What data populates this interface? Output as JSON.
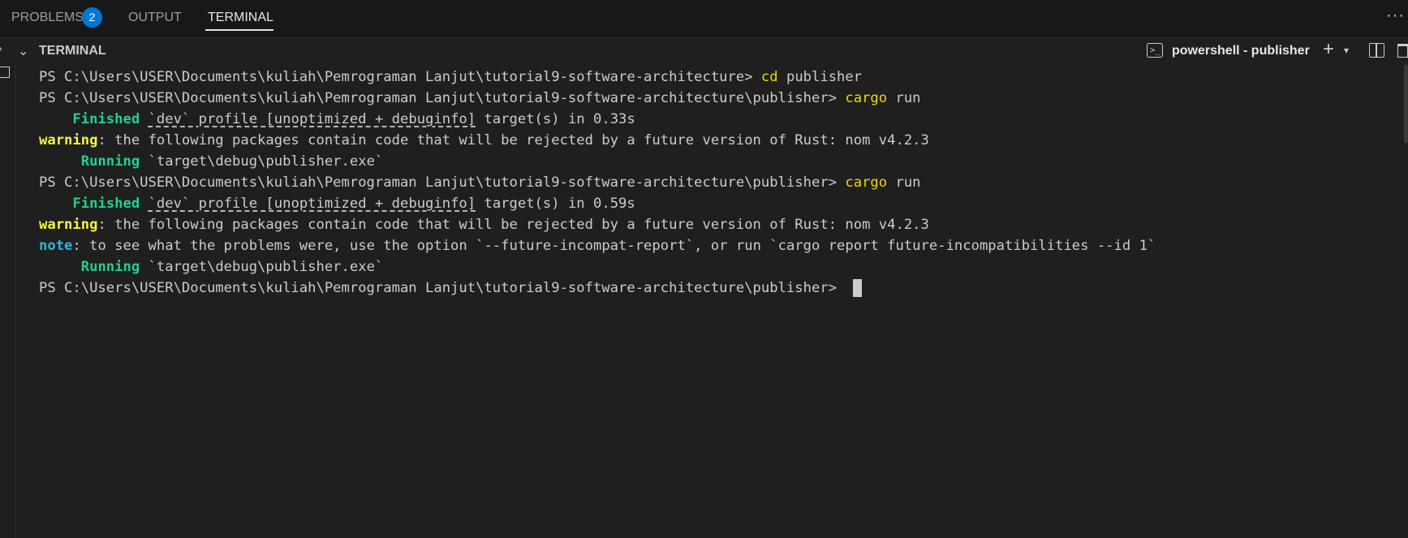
{
  "tabs": {
    "problems": {
      "label": "PROBLEMS",
      "badge": "2"
    },
    "output": {
      "label": "OUTPUT"
    },
    "terminal": {
      "label": "TERMINAL"
    },
    "more_icon": "ellipsis-icon"
  },
  "panel": {
    "section_title": "TERMINAL",
    "shell_name": "powershell - publisher",
    "shell_icon_glyph": ">_",
    "actions": {
      "new_terminal": "+",
      "new_terminal_dropdown": "⌄"
    }
  },
  "colors": {
    "background": "#1f1f1f",
    "prompt_command": "#f1d600",
    "status_green": "#23d18b",
    "warning": "#f5f543",
    "note": "#29b8db",
    "badge": "#0078d4"
  },
  "terminal": {
    "lines": [
      {
        "prompt": "PS C:\\Users\\USER\\Documents\\kuliah\\Pemrograman Lanjut\\tutorial9-software-architecture> ",
        "cmd": "cd",
        "arg": " publisher"
      },
      {
        "prompt": "PS C:\\Users\\USER\\Documents\\kuliah\\Pemrograman Lanjut\\tutorial9-software-architecture\\publisher> ",
        "cmd": "cargo",
        "arg": " run"
      },
      {
        "indent": "    ",
        "status": "Finished",
        "space": " ",
        "profile": "`dev` profile [unoptimized + debuginfo]",
        "rest": " target(s) in 0.33s"
      },
      {
        "kind": "warning",
        "label": "warning",
        "rest": ": the following packages contain code that will be rejected by a future version of Rust: nom v4.2.3"
      },
      {
        "indent": "     ",
        "status": "Running",
        "rest": " `target\\debug\\publisher.exe`"
      },
      {
        "prompt": "PS C:\\Users\\USER\\Documents\\kuliah\\Pemrograman Lanjut\\tutorial9-software-architecture\\publisher> ",
        "cmd": "cargo",
        "arg": " run"
      },
      {
        "indent": "    ",
        "status": "Finished",
        "space": " ",
        "profile": "`dev` profile [unoptimized + debuginfo]",
        "rest": " target(s) in 0.59s"
      },
      {
        "kind": "warning",
        "label": "warning",
        "rest": ": the following packages contain code that will be rejected by a future version of Rust: nom v4.2.3"
      },
      {
        "kind": "note",
        "label": "note",
        "rest": ": to see what the problems were, use the option `--future-incompat-report`, or run `cargo report future-incompatibilities --id 1`"
      },
      {
        "indent": "     ",
        "status": "Running",
        "rest": " `target\\debug\\publisher.exe`"
      },
      {
        "prompt": "PS C:\\Users\\USER\\Documents\\kuliah\\Pemrograman Lanjut\\tutorial9-software-architecture\\publisher> ",
        "cmd": "",
        "arg": ""
      }
    ]
  }
}
